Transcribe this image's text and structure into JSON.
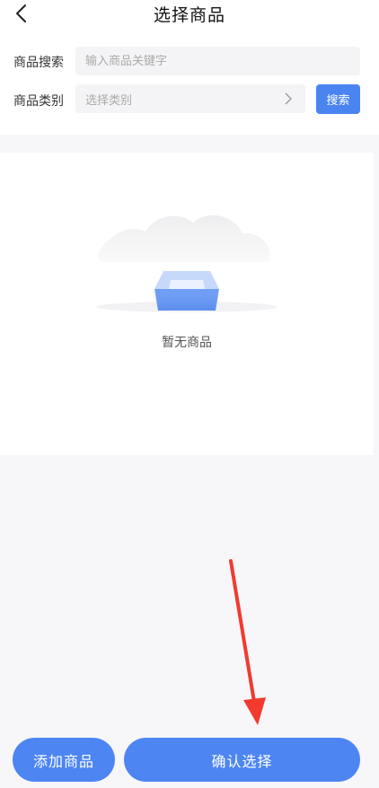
{
  "header": {
    "title": "选择商品",
    "back_icon": "chevron-left-icon"
  },
  "filters": {
    "search": {
      "label": "商品搜索",
      "placeholder": "输入商品关键字",
      "value": ""
    },
    "category": {
      "label": "商品类别",
      "placeholder": "选择类别",
      "icon": "chevron-right-icon"
    },
    "search_button_label": "搜索"
  },
  "empty_state": {
    "text": "暂无商品",
    "icon": "empty-box-icon"
  },
  "footer": {
    "add_label": "添加商品",
    "confirm_label": "确认选择"
  },
  "colors": {
    "accent": "#4a84f0",
    "annotation_arrow": "#f23a2e"
  }
}
